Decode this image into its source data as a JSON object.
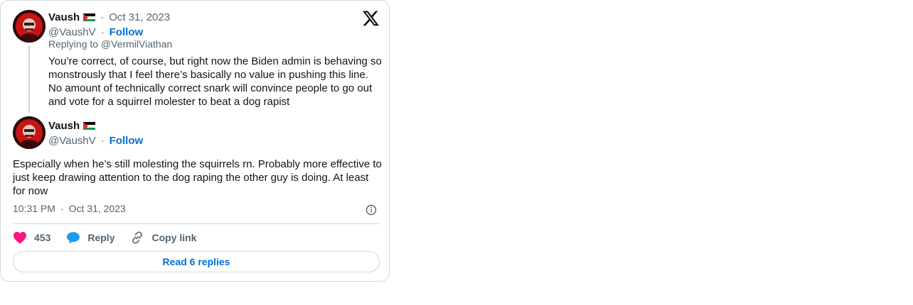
{
  "quoted_tweet": {
    "author_name": "Vaush",
    "author_flag_icon": "palestine-flag-icon",
    "date": "Oct 31, 2023",
    "handle": "@VaushV",
    "follow_label": "Follow",
    "replying_to": "Replying to @VermilViathan",
    "text": "You’re correct, of course, but right now the Biden admin is behaving so monstrously that I feel there’s basically no value in pushing this line. No amount of technically correct snark will convince people to go out and vote for a squirrel molester to beat a dog rapist"
  },
  "main_tweet": {
    "author_name": "Vaush",
    "author_flag_icon": "palestine-flag-icon",
    "handle": "@VaushV",
    "follow_label": "Follow",
    "text": "Especially when he’s still molesting the squirrels rn. Probably more effective to just keep drawing attention to the dog raping the other guy is doing. At least for now",
    "time": "10:31 PM",
    "date": "Oct 31, 2023"
  },
  "actions": {
    "like_count": "453",
    "reply_label": "Reply",
    "copy_link_label": "Copy link",
    "read_replies_label": "Read 6 replies"
  },
  "separator": "·",
  "colors": {
    "link_blue": "#006fd6",
    "like_pink": "#f91880",
    "reply_blue": "#1d9bf0",
    "muted_gray": "#536471",
    "border": "#cfd9de"
  }
}
